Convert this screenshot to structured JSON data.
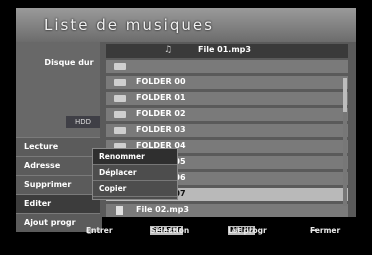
{
  "title": "Liste de musiques",
  "left_panel": {
    "disc_label": "Disque dur",
    "disc_button": "HDD",
    "menu": [
      "Lecture",
      "Adresse",
      "Supprimer",
      "Editer",
      "Ajout progr"
    ]
  },
  "list": {
    "header_file": "File 01.mp3",
    "rows": [
      "FOLDER 00",
      "FOLDER 01",
      "FOLDER 02",
      "FOLDER 03",
      "FOLDER 04",
      "FOLDER 05",
      "FOLDER 06",
      "FOLDER 07"
    ],
    "last_file": "File 02.mp3"
  },
  "popup": [
    "Renommer",
    "Déplacer",
    "Copier"
  ],
  "help": {
    "enter": "Entrer",
    "selection_key": "SELECT",
    "selection": "Sélection",
    "menu_key": "MENU",
    "menu": "Lst progr",
    "close": "Fermer"
  }
}
